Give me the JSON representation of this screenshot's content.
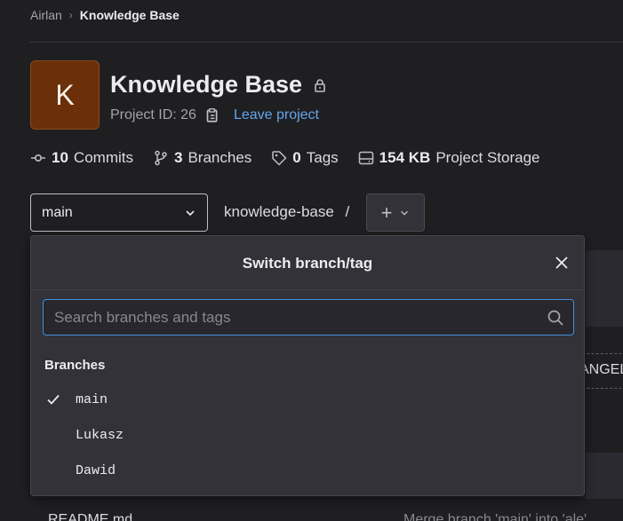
{
  "breadcrumb": {
    "parent": "Airlan",
    "current": "Knowledge Base"
  },
  "project": {
    "avatar_letter": "K",
    "title": "Knowledge Base",
    "id_text": "Project ID: 26",
    "leave_label": "Leave project",
    "avatar_color": "#6b2f0a"
  },
  "stats": {
    "commits_count": "10",
    "commits_label": "Commits",
    "branches_count": "3",
    "branches_label": "Branches",
    "tags_count": "0",
    "tags_label": "Tags",
    "storage_size": "154 KB",
    "storage_label": "Project Storage"
  },
  "branch_selector": {
    "value": "main"
  },
  "repo_path": {
    "name": "knowledge-base",
    "sep": "/"
  },
  "add_button": {
    "symbol": "+"
  },
  "background": {
    "badge_text": "ANGEL",
    "readme": "README.md",
    "commit_msg": "Merge branch 'main' into 'ale'"
  },
  "dropdown": {
    "title": "Switch branch/tag",
    "search_placeholder": "Search branches and tags",
    "section_label": "Branches",
    "branches": [
      {
        "name": "main",
        "selected": true
      },
      {
        "name": "Lukasz",
        "selected": false
      },
      {
        "name": "Dawid",
        "selected": false
      }
    ]
  },
  "colors": {
    "accent": "#63a6e9",
    "focus_border": "#428fdc"
  }
}
